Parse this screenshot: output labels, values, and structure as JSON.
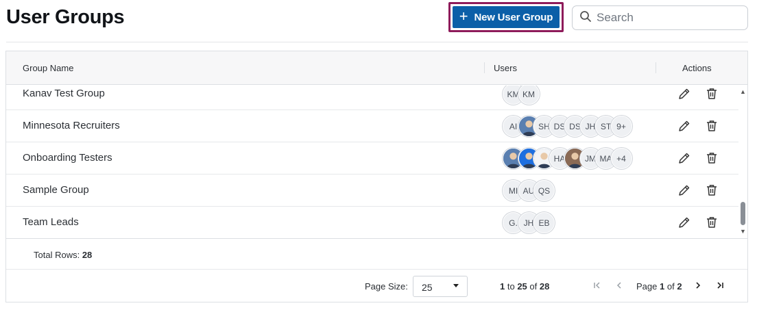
{
  "page": {
    "title": "User Groups"
  },
  "toolbar": {
    "new_group_label": "New User Group",
    "plus_icon": "+"
  },
  "search": {
    "placeholder": "Search"
  },
  "table": {
    "columns": {
      "group_name": "Group Name",
      "users": "Users",
      "actions": "Actions"
    },
    "rows": [
      {
        "name": "Kanav Test Group",
        "avatars": [
          "KM",
          "KM"
        ]
      },
      {
        "name": "Minnesota Recruiters",
        "avatars": [
          "AI",
          "photo",
          "SH",
          "DS",
          "DS",
          "JH",
          "ST",
          "9+"
        ]
      },
      {
        "name": "Onboarding Testers",
        "avatars": [
          "photo",
          "photo",
          "photo",
          "HA",
          "photo",
          "JM",
          "MA",
          "+4"
        ]
      },
      {
        "name": "Sample Group",
        "avatars": [
          "MI",
          "AU",
          "QS"
        ]
      },
      {
        "name": "Team Leads",
        "avatars": [
          "G.",
          "JH",
          "EB"
        ]
      }
    ]
  },
  "footer": {
    "total_label": "Total Rows:",
    "total_value": "28",
    "page_size_label": "Page Size:",
    "page_size_value": "25",
    "range_from": "1",
    "range_to_label": "to",
    "range_to": "25",
    "range_of_label": "of",
    "range_total": "28",
    "page_label": "Page",
    "page_current": "1",
    "page_of_label": "of",
    "page_total": "2"
  },
  "colors": {
    "primary": "#0b5fa8",
    "focus_ring": "#8e1b5a"
  }
}
